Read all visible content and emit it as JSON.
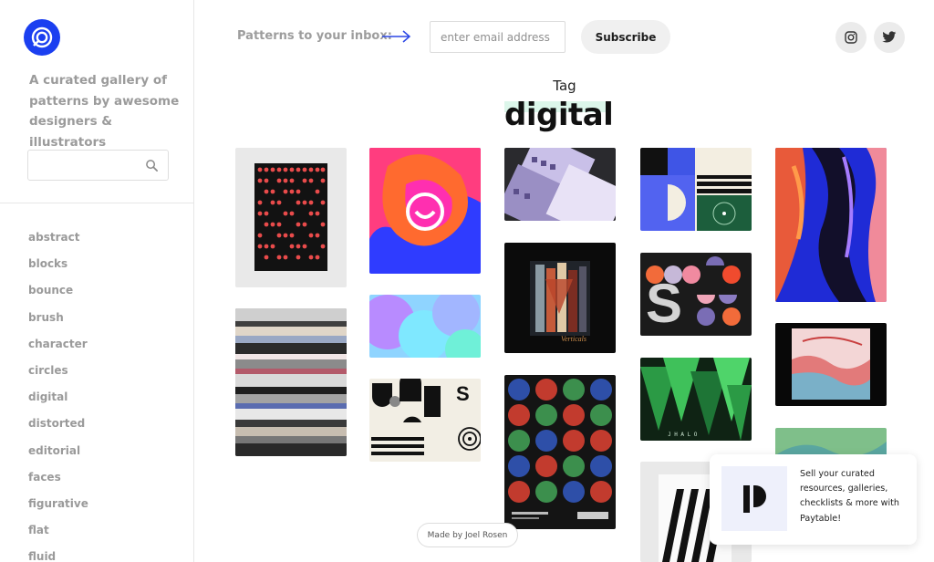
{
  "sidebar": {
    "tagline": "A curated gallery of patterns by awesome designers & illustrators",
    "search_placeholder": "",
    "tags": [
      "abstract",
      "blocks",
      "bounce",
      "brush",
      "character",
      "circles",
      "digital",
      "distorted",
      "editorial",
      "faces",
      "figurative",
      "flat",
      "fluid"
    ]
  },
  "header": {
    "newsletter_label": "Patterns to your inbox:",
    "email_placeholder": "enter email address",
    "subscribe_label": "Subscribe"
  },
  "page": {
    "kicker": "Tag",
    "title": "digital"
  },
  "gallery": {
    "items": [
      {
        "name": "poster-red-dots",
        "color": "#e8e8e8"
      },
      {
        "name": "glitch-streaks",
        "color": "#7a7a7a"
      },
      {
        "name": "neon-smiley",
        "color": "#ff3d7f"
      },
      {
        "name": "gradient-blobs",
        "color": "#7fb8ff"
      },
      {
        "name": "geometric-shapes-cream",
        "color": "#f1ecdf"
      },
      {
        "name": "purple-geometric-cards",
        "color": "#5a5a66"
      },
      {
        "name": "verticals-poster",
        "color": "#0b0b0b"
      },
      {
        "name": "circle-grid-poster",
        "color": "#111111"
      },
      {
        "name": "blue-green-geometric",
        "color": "#3c4bdc"
      },
      {
        "name": "s-shapes-poster",
        "color": "#1a1a1a"
      },
      {
        "name": "green-triangles",
        "color": "#0e2b17"
      },
      {
        "name": "black-white-stripes",
        "color": "#e8e8e8"
      },
      {
        "name": "fluid-blue-orange",
        "color": "#2433c9"
      },
      {
        "name": "pink-landscape",
        "color": "#080808"
      },
      {
        "name": "green-gradient",
        "color": "#7fbf8a"
      }
    ]
  },
  "footer": {
    "credit": "Made by Joel Rosen",
    "promo_text": "Sell your curated resources, galleries, checklists & more with Paytable!"
  },
  "colors": {
    "brand_blue": "#1b3ff0",
    "muted_text": "#9b9b9b",
    "title_highlight": "#dcf6ea"
  },
  "icons": {
    "logo": "pattern-spiral-logo",
    "search": "search-icon",
    "arrow": "arrow-right-icon",
    "instagram": "instagram-icon",
    "twitter": "twitter-icon",
    "promo": "paytable-logo"
  }
}
